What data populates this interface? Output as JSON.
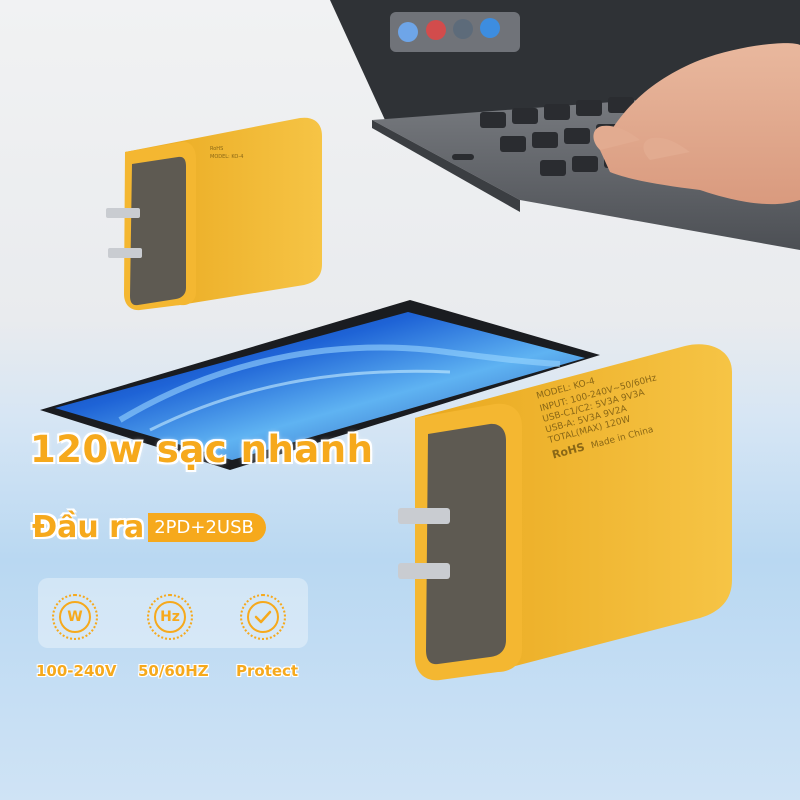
{
  "headline": "120w sạc nhanh",
  "output": {
    "label": "Đầu ra",
    "ports": "2PD+2USB"
  },
  "features": [
    {
      "icon": "watt-icon",
      "icon_text": "W",
      "label": "100-240V"
    },
    {
      "icon": "hertz-icon",
      "icon_text": "Hz",
      "label": "50/60HZ"
    },
    {
      "icon": "check-icon",
      "icon_text": "",
      "label": "Protect"
    }
  ],
  "charger_label": {
    "model": "MODEL: KO-4",
    "lines": [
      "INPUT: 100-240V~50/60Hz",
      "USB-C1/C2: 5V3A 9V3A",
      "USB-A: 5V3A 9V2A",
      "TOTAL(MAX) 120W"
    ],
    "brand": "RoHS",
    "origin": "Made in China"
  },
  "colors": {
    "accent": "#f6a91c",
    "charger_body": "#f0b72e",
    "charger_face": "#5e5a52",
    "sky": "#b9d8f2"
  }
}
